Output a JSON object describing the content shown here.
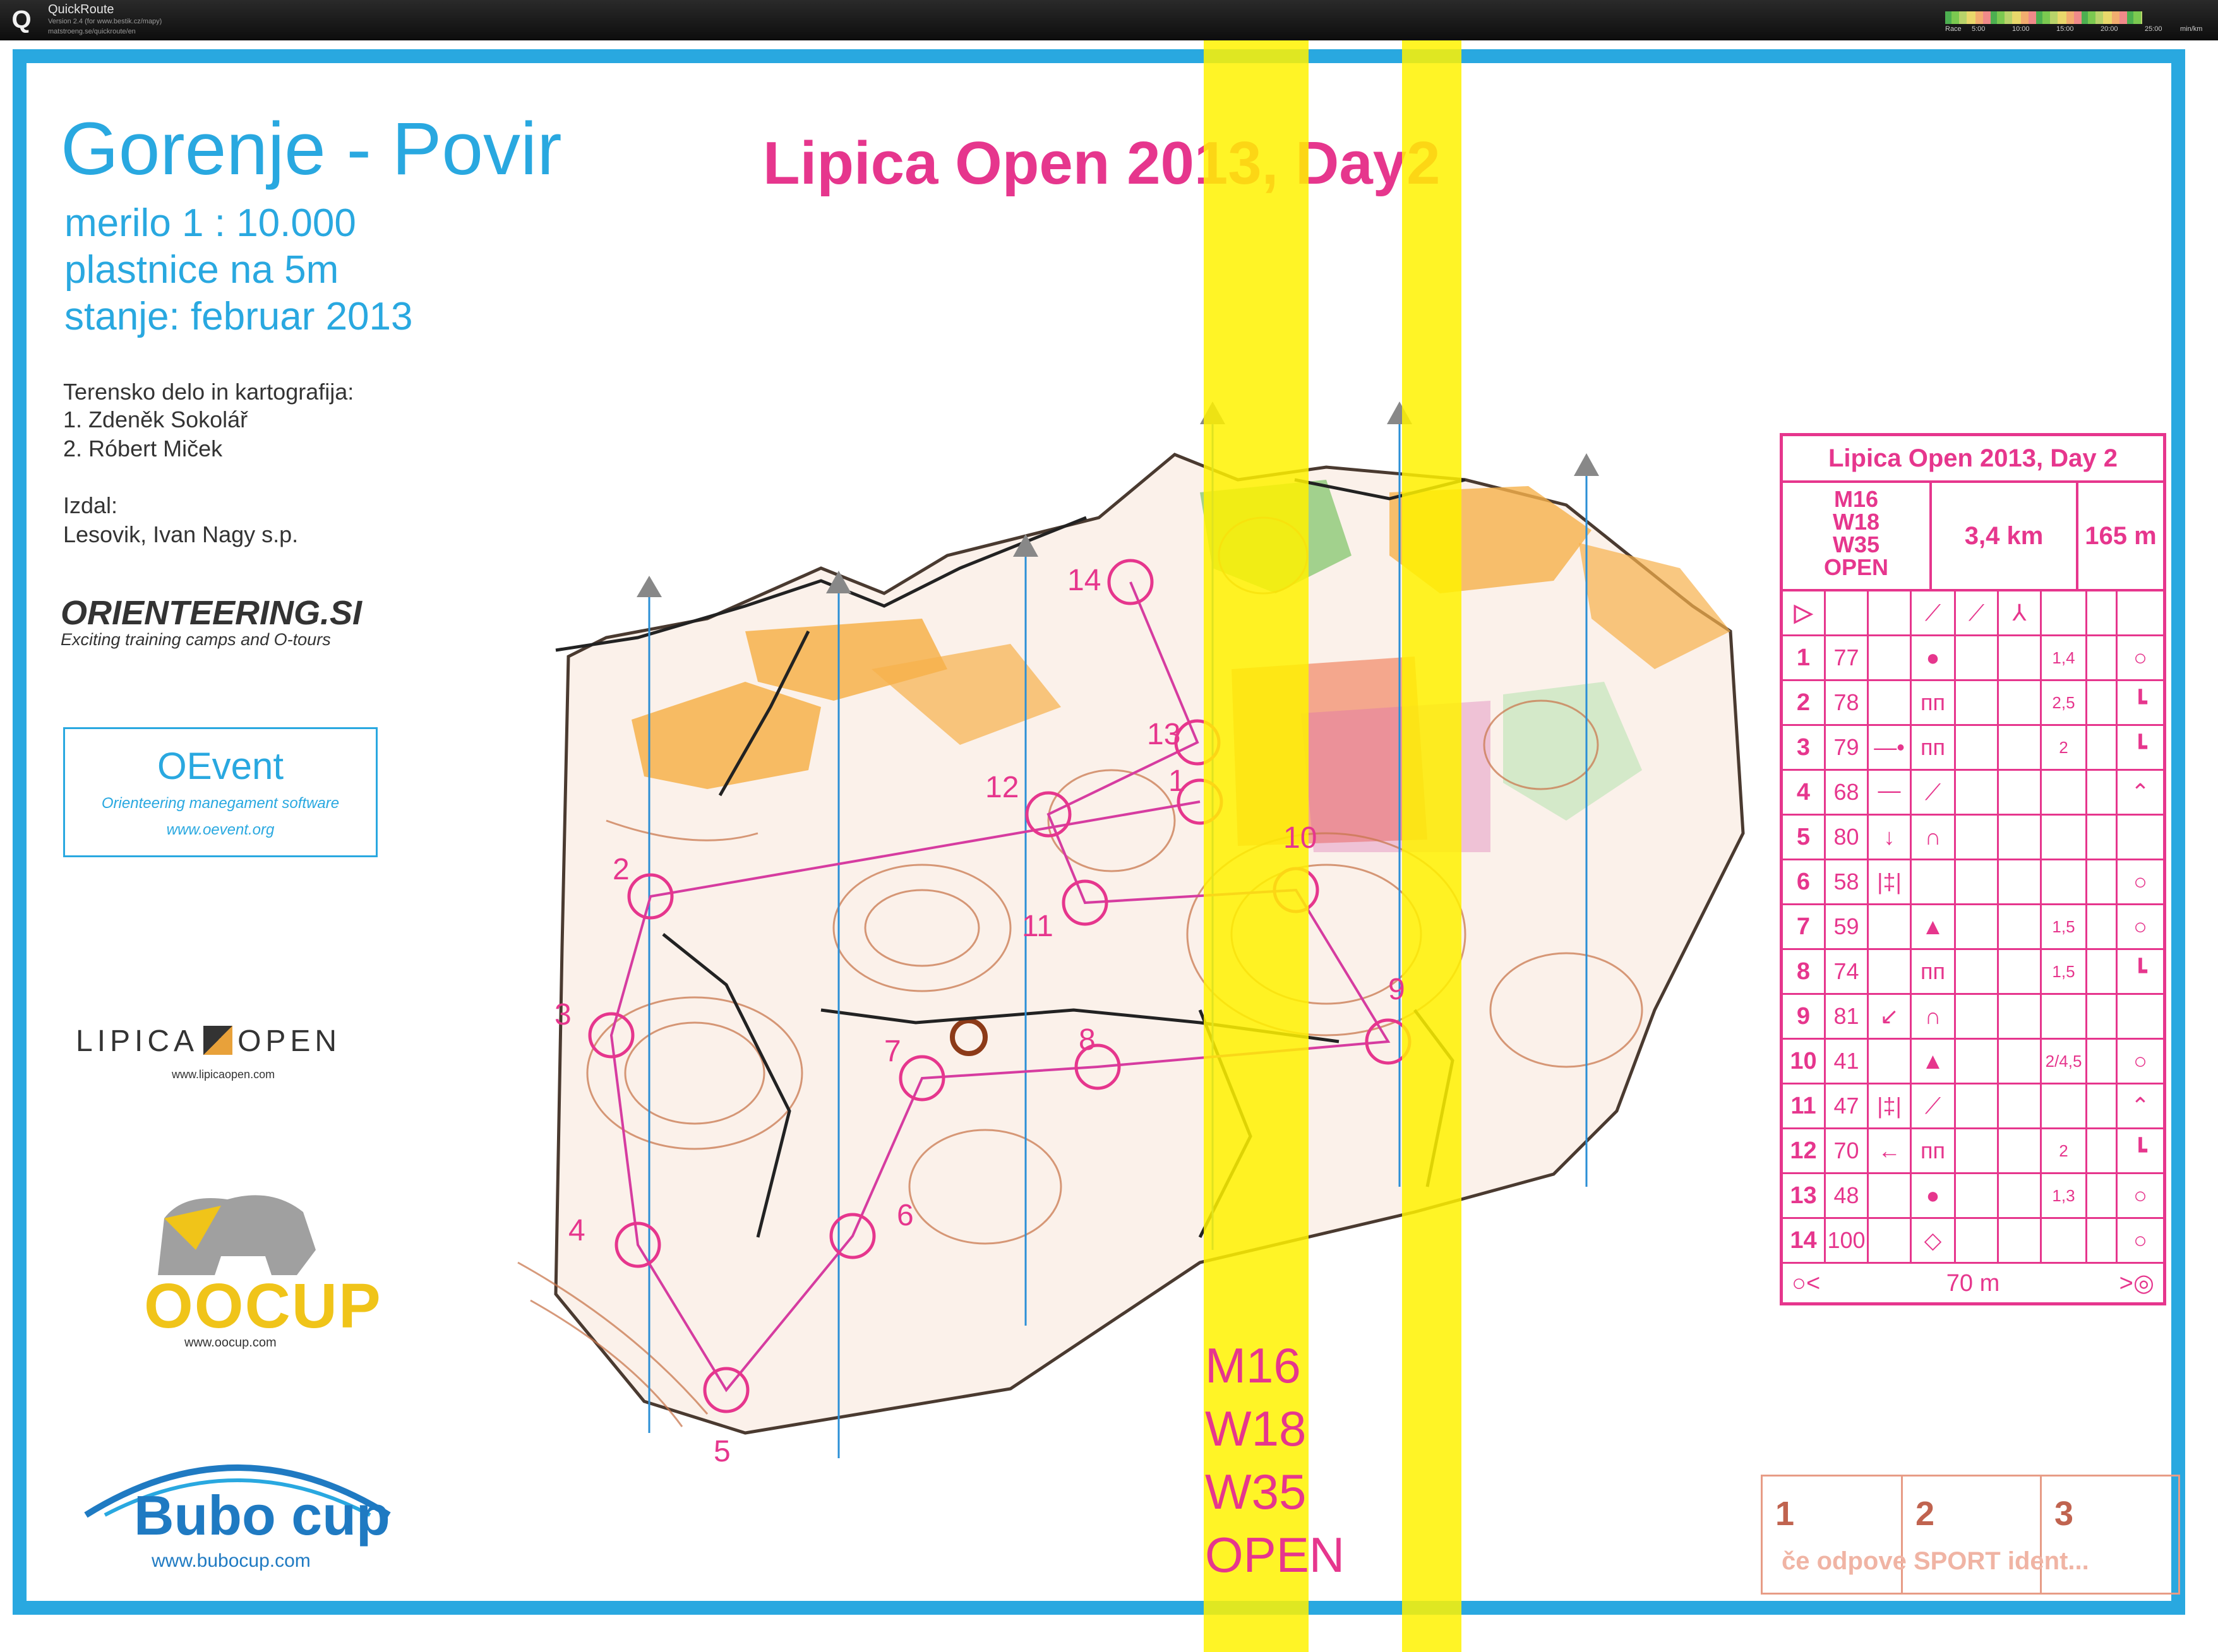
{
  "window": {
    "app_title": "QuickRoute",
    "version_text": "Version 2.4 (for www.bestik.cz/mapy)",
    "site_text": "matstroeng.se/quickroute/en",
    "legend_label": "Race",
    "legend_ticks": [
      "5:00",
      "10:00",
      "15:00",
      "20:00",
      "25:00"
    ],
    "legend_unit": "min/km"
  },
  "map_info": {
    "name": "Gorenje - Povir",
    "scale": "merilo 1 : 10.000",
    "contours": "plastnice na 5m",
    "status": "stanje: februar 2013",
    "fieldwork_label": "Terensko delo in kartografija:",
    "mapper_1": "1. Zdeněk Sokolář",
    "mapper_2": "2. Róbert Miček",
    "publisher_label": "Izdal:",
    "publisher": "Lesovik, Ivan Nagy s.p."
  },
  "sponsors": {
    "orienteering_si": "ORIENTEERING.SI",
    "orienteering_tag": "Exciting training camps and O-tours",
    "oevent_name": "OEvent",
    "oevent_sub": "Orienteering manegament software",
    "oevent_url": "www.oevent.org",
    "lipica_left": "LIPICA",
    "lipica_right": "OPEN",
    "lipica_url": "www.lipicaopen.com",
    "oocup": "OOCUP",
    "oocup_url": "www.oocup.com",
    "bubo": "Bubo cup",
    "bubo_url": "www.bubocup.com"
  },
  "event_title": "Lipica Open 2013, Day2",
  "classes_bottom": [
    "M16",
    "W18",
    "W35",
    "OPEN"
  ],
  "course": {
    "title": "Lipica Open 2013, Day 2",
    "classes": [
      "M16",
      "W18",
      "W35",
      "OPEN"
    ],
    "length": "3,4 km",
    "climb": "165 m",
    "finish_distance": "70 m",
    "controls": [
      {
        "num": "1",
        "code": "77",
        "d": "",
        "e": "●",
        "f": "",
        "g": "",
        "h": "1,4",
        "j": "○"
      },
      {
        "num": "2",
        "code": "78",
        "d": "",
        "e": "ᴨᴨ",
        "f": "",
        "g": "",
        "h": "2,5",
        "j": "┗"
      },
      {
        "num": "3",
        "code": "79",
        "d": "—•—",
        "e": "ᴨᴨ",
        "f": "",
        "g": "",
        "h": "2",
        "j": "┗"
      },
      {
        "num": "4",
        "code": "68",
        "d": "",
        "e": "⟋",
        "f": "",
        "g": "",
        "h": "",
        "j": "⌃"
      },
      {
        "num": "5",
        "code": "80",
        "d": "↓",
        "e": "∩",
        "f": "",
        "g": "",
        "h": "",
        "j": ""
      },
      {
        "num": "6",
        "code": "58",
        "d": "|‡|",
        "e": "",
        "f": "",
        "g": "",
        "h": "",
        "j": "○"
      },
      {
        "num": "7",
        "code": "59",
        "d": "",
        "e": "▲",
        "f": "",
        "g": "",
        "h": "1,5",
        "j": "○"
      },
      {
        "num": "8",
        "code": "74",
        "d": "",
        "e": "ᴨᴨ",
        "f": "",
        "g": "",
        "h": "1,5",
        "j": "┗"
      },
      {
        "num": "9",
        "code": "81",
        "d": "↙",
        "e": "∩",
        "f": "",
        "g": "",
        "h": "",
        "j": ""
      },
      {
        "num": "10",
        "code": "41",
        "d": "",
        "e": "▲",
        "f": "",
        "g": "",
        "h": "2/4,5",
        "j": "○"
      },
      {
        "num": "11",
        "code": "47",
        "d": "|‡|",
        "e": "⟋",
        "f": "",
        "g": "",
        "h": "",
        "j": "⌃"
      },
      {
        "num": "12",
        "code": "70",
        "d": "←",
        "e": "ᴨᴨ",
        "f": "",
        "g": "",
        "h": "2",
        "j": "┗"
      },
      {
        "num": "13",
        "code": "48",
        "d": "",
        "e": "●",
        "f": "",
        "g": "",
        "h": "1,3",
        "j": "○"
      },
      {
        "num": "14",
        "code": "100",
        "d": "",
        "e": "◇",
        "f": "",
        "g": "",
        "h": "",
        "j": "○"
      }
    ]
  },
  "map_labels": [
    "1",
    "2",
    "3",
    "4",
    "5",
    "6",
    "7",
    "8",
    "9",
    "10",
    "11",
    "12",
    "13",
    "14"
  ],
  "rental": {
    "cols": [
      "1",
      "2",
      "3"
    ],
    "text": "če odpove SPORT ident..."
  },
  "colors": {
    "frame": "#29a8e0",
    "course": "#e6368d",
    "yellow": "#fff200"
  }
}
